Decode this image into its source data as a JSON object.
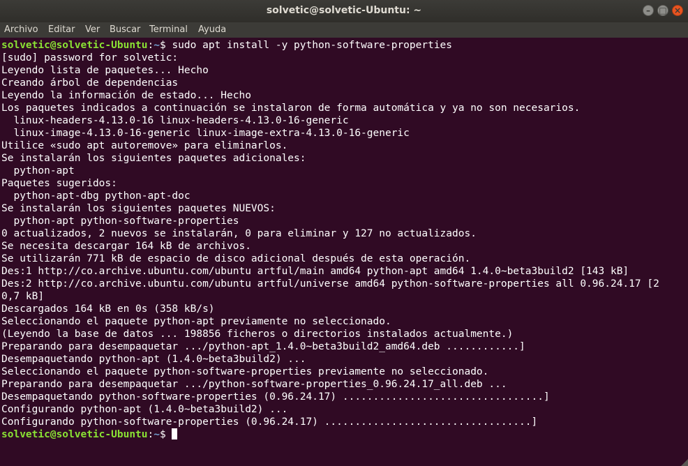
{
  "window": {
    "title": "solvetic@solvetic-Ubuntu: ~"
  },
  "menu": [
    "Archivo",
    "Editar",
    "Ver",
    "Buscar",
    "Terminal",
    "Ayuda"
  ],
  "prompt": {
    "user_host": "solvetic@solvetic-Ubuntu",
    "sep": ":",
    "path": "~",
    "symbol": "$ "
  },
  "command": "sudo apt install -y python-software-properties",
  "output": [
    "[sudo] password for solvetic:",
    "Leyendo lista de paquetes... Hecho",
    "Creando árbol de dependencias",
    "Leyendo la información de estado... Hecho",
    "Los paquetes indicados a continuación se instalaron de forma automática y ya no son necesarios.",
    "  linux-headers-4.13.0-16 linux-headers-4.13.0-16-generic",
    "  linux-image-4.13.0-16-generic linux-image-extra-4.13.0-16-generic",
    "Utilice «sudo apt autoremove» para eliminarlos.",
    "Se instalarán los siguientes paquetes adicionales:",
    "  python-apt",
    "Paquetes sugeridos:",
    "  python-apt-dbg python-apt-doc",
    "Se instalarán los siguientes paquetes NUEVOS:",
    "  python-apt python-software-properties",
    "0 actualizados, 2 nuevos se instalarán, 0 para eliminar y 127 no actualizados.",
    "Se necesita descargar 164 kB de archivos.",
    "Se utilizarán 771 kB de espacio de disco adicional después de esta operación.",
    "Des:1 http://co.archive.ubuntu.com/ubuntu artful/main amd64 python-apt amd64 1.4.0~beta3build2 [143 kB]",
    "Des:2 http://co.archive.ubuntu.com/ubuntu artful/universe amd64 python-software-properties all 0.96.24.17 [2",
    "0,7 kB]",
    "Descargados 164 kB en 0s (358 kB/s)",
    "Seleccionando el paquete python-apt previamente no seleccionado.",
    "(Leyendo la base de datos ... 198856 ficheros o directorios instalados actualmente.)",
    "Preparando para desempaquetar .../python-apt_1.4.0~beta3build2_amd64.deb ............]",
    "Desempaquetando python-apt (1.4.0~beta3build2) ...",
    "Seleccionando el paquete python-software-properties previamente no seleccionado.",
    "Preparando para desempaquetar .../python-software-properties_0.96.24.17_all.deb ...",
    "Desempaquetando python-software-properties (0.96.24.17) .................................]",
    "Configurando python-apt (1.4.0~beta3build2) ...",
    "Configurando python-software-properties (0.96.24.17) ..................................]"
  ]
}
